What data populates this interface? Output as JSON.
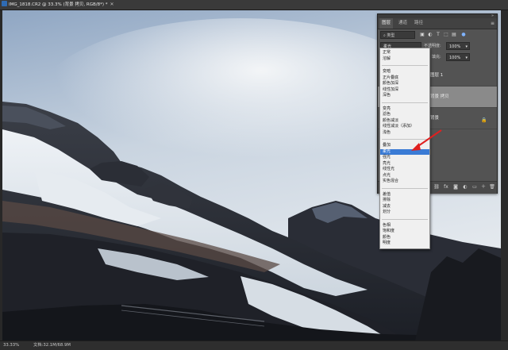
{
  "document_tab": {
    "title": "IMG_1818.CR2 @ 33.3% (背景 拷贝, RGB/8*) *"
  },
  "status_bar": {
    "zoom": "33.33%",
    "doc_size": "文档:32.1M/68.9M"
  },
  "layers_panel": {
    "tabs": [
      "图层",
      "通道",
      "路径"
    ],
    "filter_label": "类型",
    "blend_mode_value": "柔光",
    "opacity_label": "不透明度:",
    "opacity_value": "100%",
    "fill_label": "填充:",
    "fill_value": "100%",
    "layers": [
      {
        "name": "图层 1"
      },
      {
        "name": "背景 拷贝"
      },
      {
        "name": "背景"
      }
    ]
  },
  "blend_dropdown": {
    "groups": [
      [
        "正常",
        "溶解"
      ],
      [
        "变暗",
        "正片叠底",
        "颜色加深",
        "线性加深",
        "深色"
      ],
      [
        "变亮",
        "滤色",
        "颜色减淡",
        "线性减淡（添加）",
        "浅色"
      ],
      [
        "叠加",
        "柔光",
        "强光",
        "亮光",
        "线性光",
        "点光",
        "实色混合"
      ],
      [
        "差值",
        "排除",
        "减去",
        "划分"
      ],
      [
        "色相",
        "饱和度",
        "颜色",
        "明度"
      ]
    ],
    "highlighted": "柔光"
  },
  "colors": {
    "highlight": "#3a7bd5",
    "arrow": "#e02020",
    "panel_bg": "#535353"
  }
}
